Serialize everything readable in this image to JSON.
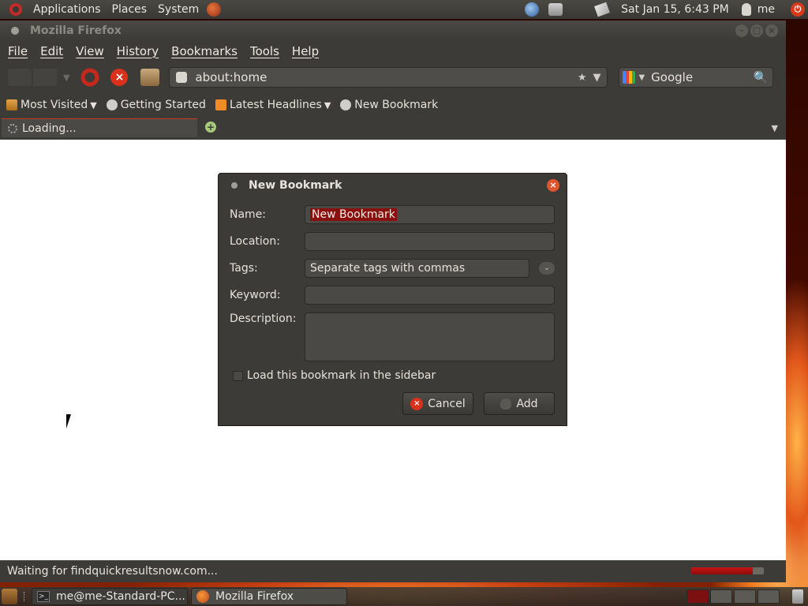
{
  "top_panel": {
    "menus": [
      "Applications",
      "Places",
      "System"
    ],
    "clock": "Sat Jan 15,  6:43 PM",
    "user": "me"
  },
  "window": {
    "title": "Mozilla Firefox"
  },
  "menubar": {
    "items": [
      "File",
      "Edit",
      "View",
      "History",
      "Bookmarks",
      "Tools",
      "Help"
    ]
  },
  "navbar": {
    "url": "about:home",
    "search_engine": "Google"
  },
  "bookmarks_bar": {
    "items": [
      {
        "label": "Most Visited",
        "icon": "folder-icon",
        "dropdown": true
      },
      {
        "label": "Getting Started",
        "icon": "page-icon",
        "dropdown": false
      },
      {
        "label": "Latest Headlines",
        "icon": "rss-icon",
        "dropdown": true
      },
      {
        "label": "New Bookmark",
        "icon": "page-icon",
        "dropdown": false
      }
    ]
  },
  "tabs": [
    {
      "label": "Loading...",
      "active": true
    }
  ],
  "status": {
    "text": "Waiting for findquickresultsnow.com...",
    "progress": 0.85
  },
  "dialog": {
    "title": "New Bookmark",
    "fields": {
      "name_label": "Name:",
      "name_value": "New Bookmark",
      "location_label": "Location:",
      "location_value": "",
      "tags_label": "Tags:",
      "tags_placeholder": "Separate tags with commas",
      "keyword_label": "Keyword:",
      "keyword_value": "",
      "description_label": "Description:",
      "description_value": ""
    },
    "sidebar_checkbox": {
      "label": "Load this bookmark in the sidebar",
      "checked": false
    },
    "buttons": {
      "cancel": "Cancel",
      "add": "Add"
    }
  },
  "taskbar": {
    "tasks": [
      {
        "label": "me@me-Standard-PC...",
        "icon": "terminal-icon"
      },
      {
        "label": "Mozilla Firefox",
        "icon": "firefox-icon"
      }
    ]
  },
  "colors": {
    "accent_red": "#c43a1a",
    "window_bg": "#3c3b37",
    "selection": "#8a0f0f"
  }
}
